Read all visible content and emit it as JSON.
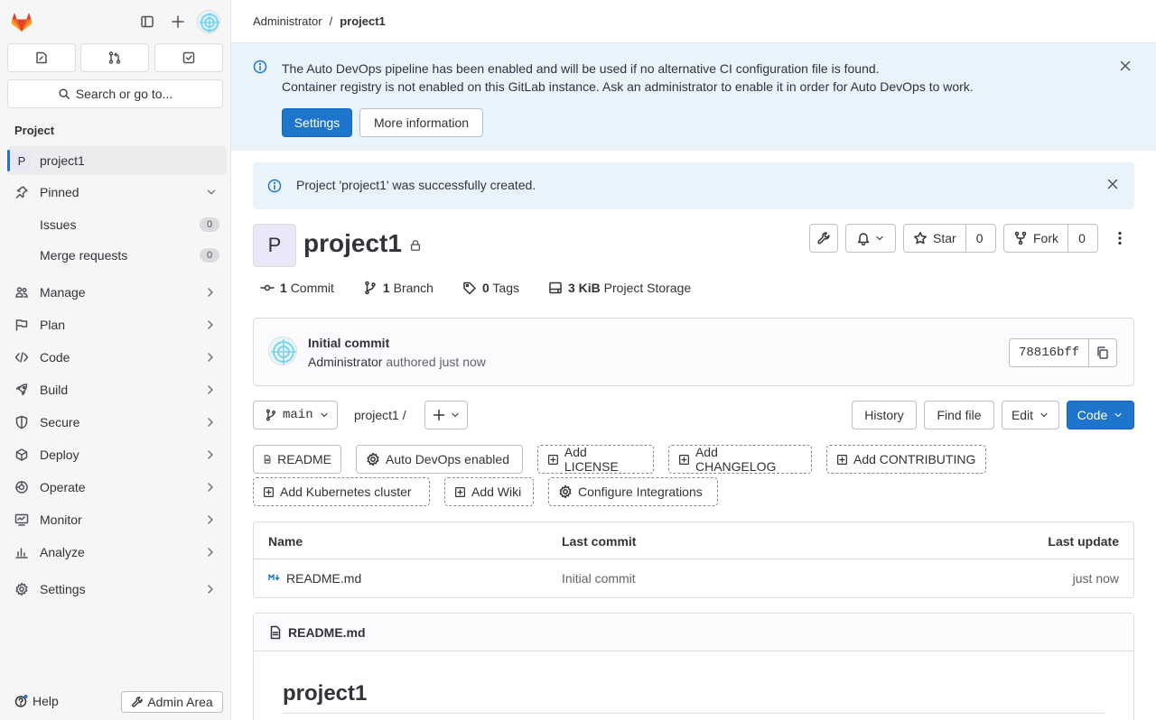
{
  "sidebar": {
    "search_label": "Search or go to...",
    "section_label": "Project",
    "project_item": {
      "badge": "P",
      "label": "project1"
    },
    "pinned": {
      "label": "Pinned",
      "items": [
        {
          "label": "Issues",
          "count": "0"
        },
        {
          "label": "Merge requests",
          "count": "0"
        }
      ]
    },
    "nav": [
      {
        "label": "Manage",
        "icon": "users-icon"
      },
      {
        "label": "Plan",
        "icon": "plan-icon"
      },
      {
        "label": "Code",
        "icon": "code-icon"
      },
      {
        "label": "Build",
        "icon": "rocket-icon"
      },
      {
        "label": "Secure",
        "icon": "shield-icon"
      },
      {
        "label": "Deploy",
        "icon": "deploy-icon"
      },
      {
        "label": "Operate",
        "icon": "operate-icon"
      },
      {
        "label": "Monitor",
        "icon": "monitor-icon"
      },
      {
        "label": "Analyze",
        "icon": "chart-icon"
      },
      {
        "label": "Settings",
        "icon": "gear-icon"
      }
    ],
    "help_label": "Help",
    "admin_label": "Admin Area"
  },
  "breadcrumb": {
    "parent": "Administrator",
    "separator": "/",
    "current": "project1"
  },
  "banner": {
    "line1": "The Auto DevOps pipeline has been enabled and will be used if no alternative CI configuration file is found.",
    "line2": "Container registry is not enabled on this GitLab instance. Ask an administrator to enable it in order for Auto DevOps to work.",
    "settings_label": "Settings",
    "more_info_label": "More information"
  },
  "alert": {
    "message": "Project 'project1' was successfully created."
  },
  "project": {
    "avatar_letter": "P",
    "title": "project1",
    "star_label": "Star",
    "star_count": "0",
    "fork_label": "Fork",
    "fork_count": "0"
  },
  "stats": [
    {
      "value": "1",
      "label": "Commit"
    },
    {
      "value": "1",
      "label": "Branch"
    },
    {
      "value": "0",
      "label": "Tags"
    },
    {
      "value": "3 KiB",
      "label": "Project Storage"
    }
  ],
  "commit": {
    "title": "Initial commit",
    "author": "Administrator",
    "meta": "authored just now",
    "sha": "78816bff"
  },
  "repo": {
    "branch": "main",
    "path": "project1",
    "path_sep": "/",
    "history_label": "History",
    "find_file_label": "Find file",
    "edit_label": "Edit",
    "code_label": "Code"
  },
  "shortcuts": {
    "readme": "README",
    "autodevops": "Auto DevOps enabled",
    "license": "Add LICENSE",
    "changelog": "Add CHANGELOG",
    "contributing": "Add CONTRIBUTING",
    "kubernetes": "Add Kubernetes cluster",
    "wiki": "Add Wiki",
    "integrations": "Configure Integrations"
  },
  "table": {
    "headers": {
      "name": "Name",
      "last_commit": "Last commit",
      "last_update": "Last update"
    },
    "rows": [
      {
        "name": "README.md",
        "last_commit": "Initial commit",
        "last_update": "just now"
      }
    ]
  },
  "readme": {
    "filename": "README.md",
    "heading": "project1"
  },
  "colors": {
    "accent": "#1f75cb",
    "banner_bg": "#e9f3fc",
    "sidebar_bg": "#f6f6f7"
  }
}
